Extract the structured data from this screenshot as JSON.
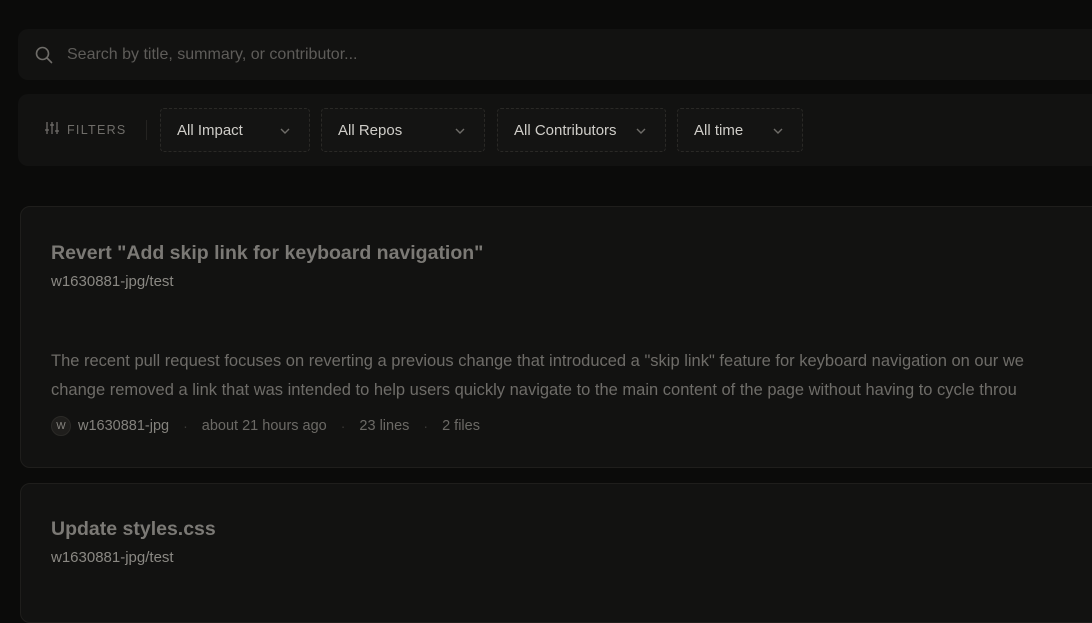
{
  "search": {
    "placeholder": "Search by title, summary, or contributor..."
  },
  "filters": {
    "label": "FILTERS",
    "impact": "All Impact",
    "repos": "All Repos",
    "contributors": "All Contributors",
    "time": "All time"
  },
  "cards": [
    {
      "title": "Revert \"Add skip link for keyboard navigation\"",
      "repo": "w1630881-jpg/test",
      "summary_line1": "The recent pull request focuses on reverting a previous change that introduced a \"skip link\" feature for keyboard navigation on our we",
      "summary_line2": "change removed a link that was intended to help users quickly navigate to the main content of the page without having to cycle throu",
      "avatar_initial": "W",
      "author": "w1630881-jpg",
      "time": "about 21 hours ago",
      "lines": "23 lines",
      "files": "2 files"
    },
    {
      "title": "Update styles.css",
      "repo": "w1630881-jpg/test"
    }
  ]
}
